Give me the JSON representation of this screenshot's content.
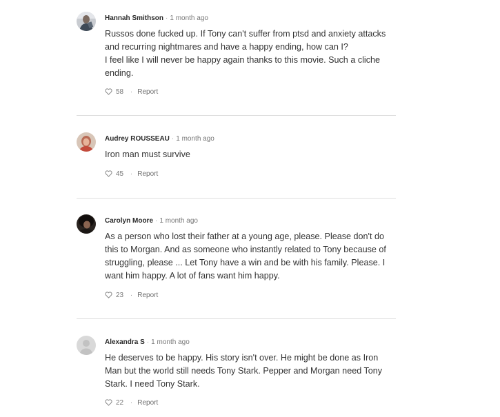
{
  "comments": [
    {
      "author": "Hannah Smithson",
      "separator": "·",
      "time": "1 month ago",
      "lines": [
        "Russos done fucked up. If Tony can't suffer from ptsd and anxiety attacks",
        "and recurring nightmares and have a happy ending, how can I?",
        "I feel like I will never be happy again thanks to this movie. Such a cliche",
        "ending."
      ],
      "likes": "58",
      "report_label": "Report",
      "action_dot": "·",
      "avatar_icon": "user-photo-icon"
    },
    {
      "author": "Audrey ROUSSEAU",
      "separator": "·",
      "time": "1 month ago",
      "lines": [
        "Iron man must survive"
      ],
      "likes": "45",
      "report_label": "Report",
      "action_dot": "·",
      "avatar_icon": "user-photo-icon"
    },
    {
      "author": "Carolyn Moore",
      "separator": "·",
      "time": "1 month ago",
      "lines": [
        "As a person who lost their father at a young age, please. Please don't do",
        "this to Morgan. And as someone who instantly related to Tony because of",
        "struggling, please ... Let Tony have a win and be with his family. Please. I",
        "want him happy. A lot of fans want him happy."
      ],
      "likes": "23",
      "report_label": "Report",
      "action_dot": "·",
      "avatar_icon": "user-photo-icon"
    },
    {
      "author": "Alexandra S",
      "separator": "·",
      "time": "1 month ago",
      "lines": [
        "He deserves to be happy. His story isn't over. He might be done as Iron",
        "Man but the world still needs Tony Stark. Pepper and Morgan need Tony",
        "Stark. I need Tony Stark."
      ],
      "likes": "22",
      "report_label": "Report",
      "action_dot": "·",
      "avatar_icon": "default-avatar-icon"
    }
  ],
  "colors": {
    "divider": "#dddddd",
    "author": "#2a2a2a",
    "muted": "#777777",
    "body": "#333333"
  }
}
